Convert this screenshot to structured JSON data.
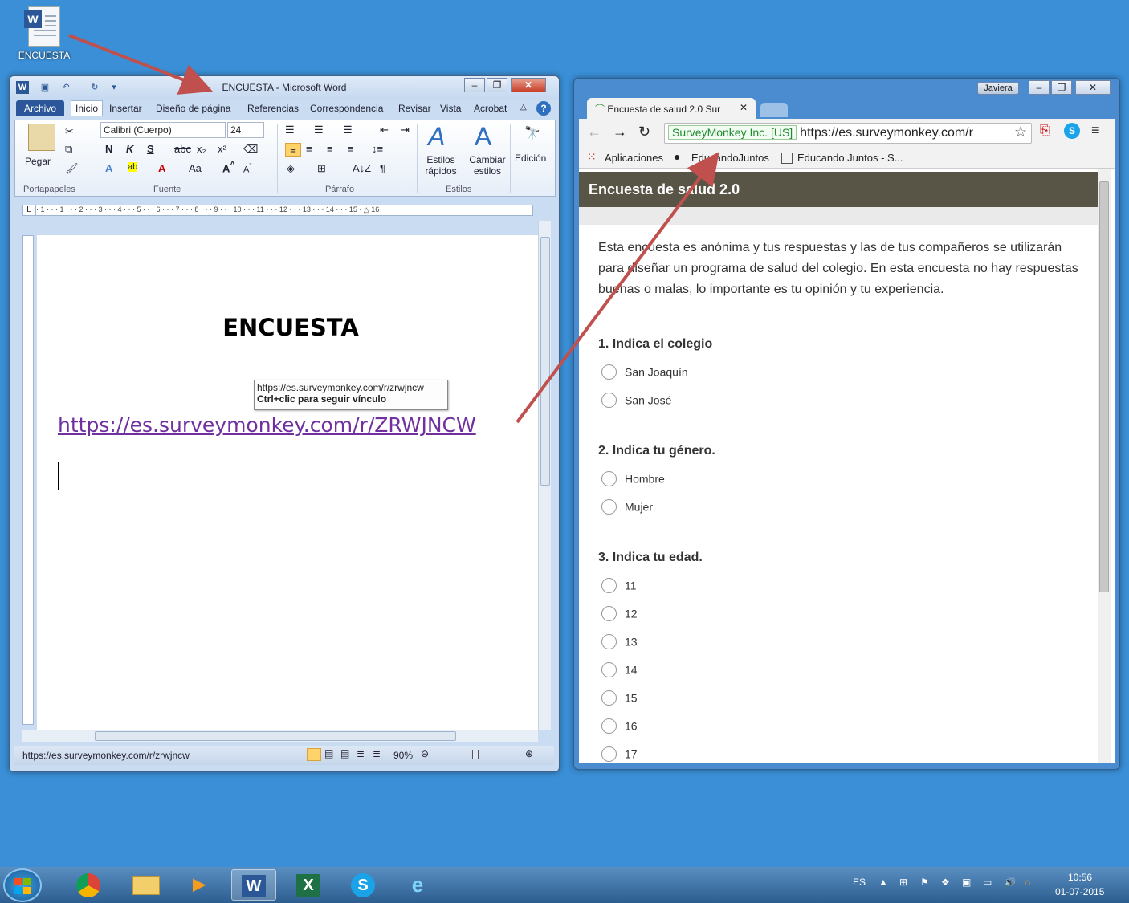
{
  "desktop": {
    "icon_label": "ENCUESTA"
  },
  "word": {
    "title": "ENCUESTA  -  Microsoft Word",
    "tabs": [
      "Archivo",
      "Inicio",
      "Insertar",
      "Diseño de página",
      "Referencias",
      "Correspondencia",
      "Revisar",
      "Vista",
      "Acrobat"
    ],
    "clipboard": {
      "paste": "Pegar",
      "group": "Portapapeles"
    },
    "font": {
      "name": "Calibri (Cuerpo)",
      "size": "24",
      "group": "Fuente",
      "bold": "N",
      "italic": "K",
      "underline": "S",
      "strike": "abc",
      "sub": "x₂",
      "sup": "x²",
      "case": "Aa"
    },
    "paragraph": {
      "group": "Párrafo",
      "pilcrow": "¶"
    },
    "styles": {
      "quick": "Estilos rápidos",
      "change": "Cambiar estilos",
      "group": "Estilos"
    },
    "editing": {
      "label": "Edición"
    },
    "ruler": "· 1 · · · 1 · · · 2 · · · 3 · · · 4 · · · 5 · · · 6 · · · 7 · · · 8 · · · 9 · · · 10 · · · 11 · · · 12 · · · 13 · · · 14 · · · 15 · △ 16",
    "doc": {
      "heading": "ENCUESTA",
      "link": "https://es.surveymonkey.com/r/ZRWJNCW",
      "tooltip_url": "https://es.surveymonkey.com/r/zrwjncw",
      "tooltip_hint": "Ctrl+clic para seguir vínculo"
    },
    "status": {
      "url": "https://es.surveymonkey.com/r/zrwjncw",
      "zoom": "90%"
    }
  },
  "chrome": {
    "user": "Javiera",
    "tab_title": "Encuesta de salud 2.0 Sur",
    "ev_label": "SurveyMonkey Inc. [US]",
    "url": "https://es.surveymonkey.com/r",
    "bookmarks": [
      "Aplicaciones",
      "EducandoJuntos",
      "Educando Juntos - S..."
    ],
    "survey": {
      "title": "Encuesta de salud 2.0",
      "intro": "Esta encuesta es anónima y tus respuestas y las de tus compañeros se utilizarán para diseñar un programa de salud del colegio. En esta encuesta no hay respuestas buenas o malas, lo importante es tu opinión y tu experiencia.",
      "questions": [
        {
          "label": "1. Indica el colegio",
          "options": [
            "San Joaquín",
            "San José"
          ]
        },
        {
          "label": "2. Indica tu género.",
          "options": [
            "Hombre",
            "Mujer"
          ]
        },
        {
          "label": "3. Indica tu edad.",
          "options": [
            "11",
            "12",
            "13",
            "14",
            "15",
            "16",
            "17"
          ]
        }
      ]
    }
  },
  "taskbar": {
    "lang": "ES",
    "time": "10:56",
    "date": "01-07-2015",
    "apps": [
      "chrome",
      "explorer",
      "media-player",
      "word",
      "excel",
      "skype",
      "internet-explorer"
    ]
  },
  "colors": {
    "desktop": "#3a8fd6",
    "survey_header": "#595546",
    "link": "#7030a0",
    "arrow": "#c0504d"
  }
}
